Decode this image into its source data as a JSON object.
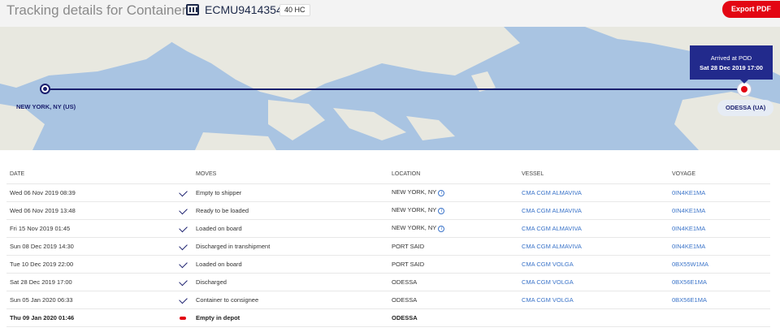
{
  "header": {
    "title": "Tracking details for Container",
    "container_id": "ECMU9414354",
    "size_type": "40 HC",
    "export_label": "Export PDF"
  },
  "map": {
    "origin": "NEW YORK, NY (US)",
    "destination": "ODESSA (UA)",
    "pod_status": "Arrived at POD",
    "pod_date": "Sat 28 Dec 2019 17:00"
  },
  "table": {
    "columns": [
      "DATE",
      "MOVES",
      "LOCATION",
      "VESSEL",
      "VOYAGE"
    ],
    "rows": [
      {
        "date": "Wed 06 Nov 2019 08:39",
        "move": "Empty to shipper",
        "location": "NEW YORK, NY",
        "vessel": "CMA CGM ALMAVIVA",
        "voyage": "0IN4KE1MA",
        "status": "done"
      },
      {
        "date": "Wed 06 Nov 2019 13:48",
        "move": "Ready to be loaded",
        "location": "NEW YORK, NY",
        "vessel": "CMA CGM ALMAVIVA",
        "voyage": "0IN4KE1MA",
        "status": "done"
      },
      {
        "date": "Fri 15 Nov 2019 01:45",
        "move": "Loaded on board",
        "location": "NEW YORK, NY",
        "vessel": "CMA CGM ALMAVIVA",
        "voyage": "0IN4KE1MA",
        "status": "done"
      },
      {
        "date": "Sun 08 Dec 2019 14:30",
        "move": "Discharged in transhipment",
        "location": "PORT SAID",
        "vessel": "CMA CGM ALMAVIVA",
        "voyage": "0IN4KE1MA",
        "status": "done"
      },
      {
        "date": "Tue 10 Dec 2019 22:00",
        "move": "Loaded on board",
        "location": "PORT SAID",
        "vessel": "CMA CGM VOLGA",
        "voyage": "0BX55W1MA",
        "status": "done"
      },
      {
        "date": "Sat 28 Dec 2019 17:00",
        "move": "Discharged",
        "location": "ODESSA",
        "vessel": "CMA CGM VOLGA",
        "voyage": "0BX56E1MA",
        "status": "done"
      },
      {
        "date": "Sun 05 Jan 2020 06:33",
        "move": "Container to consignee",
        "location": "ODESSA",
        "vessel": "CMA CGM VOLGA",
        "voyage": "0BX56E1MA",
        "status": "done"
      },
      {
        "date": "Thu 09 Jan 2020 01:46",
        "move": "Empty in depot",
        "location": "ODESSA",
        "vessel": "",
        "voyage": "",
        "status": "current"
      }
    ]
  },
  "icons": {
    "container": "container-icon",
    "check": "check-icon",
    "current": "current-status-icon",
    "info": "info-icon"
  },
  "colors": {
    "brand_red": "#e30613",
    "navy": "#1a1f6e",
    "link_blue": "#3b74c9",
    "pod_box": "#222a8c"
  }
}
